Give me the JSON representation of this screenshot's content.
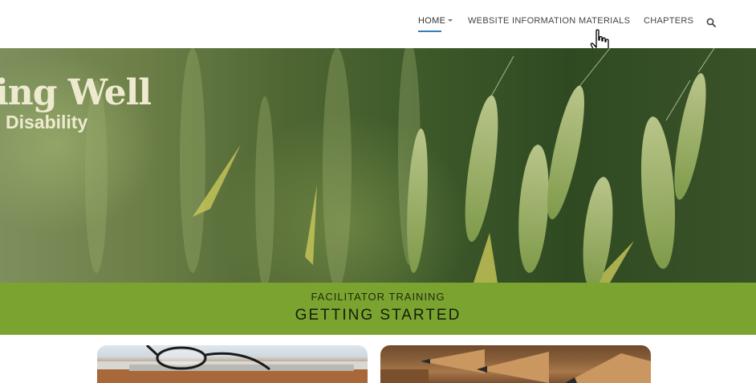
{
  "nav": {
    "items": [
      {
        "label": "HOME",
        "active": true
      },
      {
        "label": "WEBSITE INFORMATION"
      },
      {
        "label": "MATERIALS"
      },
      {
        "label": "CHAPTERS"
      }
    ],
    "search_icon": "search-icon",
    "accent_color": "#2f7fc1"
  },
  "hero": {
    "title": "ing Well",
    "subtitle": "Disability",
    "image": "wheat-field-photo"
  },
  "banner": {
    "kicker": "FACILITATOR TRAINING",
    "title": "GETTING STARTED",
    "color": "#7ba32f"
  },
  "cards": [
    {
      "image": "eyeglasses-on-laptop-photo"
    },
    {
      "image": "colored-pencils-photo"
    }
  ]
}
